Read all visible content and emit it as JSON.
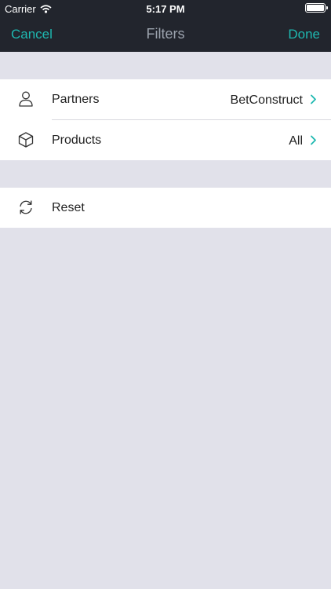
{
  "status_bar": {
    "carrier": "Carrier",
    "time": "5:17 PM",
    "wifi_icon": "wifi-icon",
    "battery_icon": "battery-icon"
  },
  "nav": {
    "cancel_label": "Cancel",
    "title": "Filters",
    "done_label": "Done"
  },
  "filters": [
    {
      "icon": "person-icon",
      "label": "Partners",
      "value": "BetConstruct"
    },
    {
      "icon": "box-icon",
      "label": "Products",
      "value": "All"
    }
  ],
  "actions": [
    {
      "icon": "refresh-icon",
      "label": "Reset"
    }
  ],
  "colors": {
    "accent": "#1eb8b0",
    "nav_background": "#22252d",
    "page_background": "#e1e1ea",
    "title": "#9ca3ae"
  }
}
